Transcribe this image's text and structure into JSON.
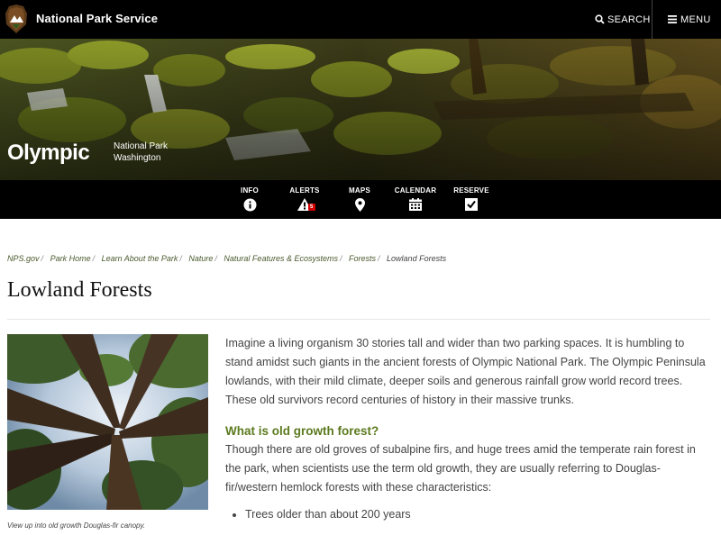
{
  "header": {
    "brand": "National Park Service",
    "search_label": "SEARCH",
    "menu_label": "MENU"
  },
  "banner": {
    "title": "Olympic",
    "subtitle_line1": "National Park",
    "subtitle_line2": "Washington"
  },
  "park_nav": {
    "items": [
      {
        "label": "INFO",
        "icon": "info-circle-icon"
      },
      {
        "label": "ALERTS",
        "icon": "alert-triangle-icon",
        "badge": "5"
      },
      {
        "label": "MAPS",
        "icon": "map-pin-icon"
      },
      {
        "label": "CALENDAR",
        "icon": "calendar-icon"
      },
      {
        "label": "RESERVE",
        "icon": "checkbox-icon"
      }
    ]
  },
  "breadcrumb": [
    "NPS.gov",
    "Park Home",
    "Learn About the Park",
    "Nature",
    "Natural Features & Ecosystems",
    "Forests",
    "Lowland Forests"
  ],
  "page": {
    "title": "Lowland Forests",
    "image_caption": "View up into old growth Douglas-fir canopy.",
    "intro": "Imagine a living organism 30 stories tall and wider than two parking spaces. It is humbling to stand amidst such giants in the ancient forests of Olympic National Park. The Olympic Peninsula lowlands, with their mild climate, deeper soils and generous rainfall grow world record trees. These old survivors record centuries of history in their massive trunks.",
    "subhead": "What is old growth forest?",
    "paragraph2": "Though there are old groves of subalpine firs, and huge trees amid the temperate rain forest in the park, when scientists use the term old growth, they are usually referring to Douglas-fir/western hemlock forests with these characteristics:",
    "bullets": [
      "Trees older than about 200 years"
    ]
  },
  "colors": {
    "header_bg": "#000000",
    "link_green": "#4a5a2e",
    "subhead_green": "#5c7a1e",
    "alert_red": "#d40000"
  }
}
